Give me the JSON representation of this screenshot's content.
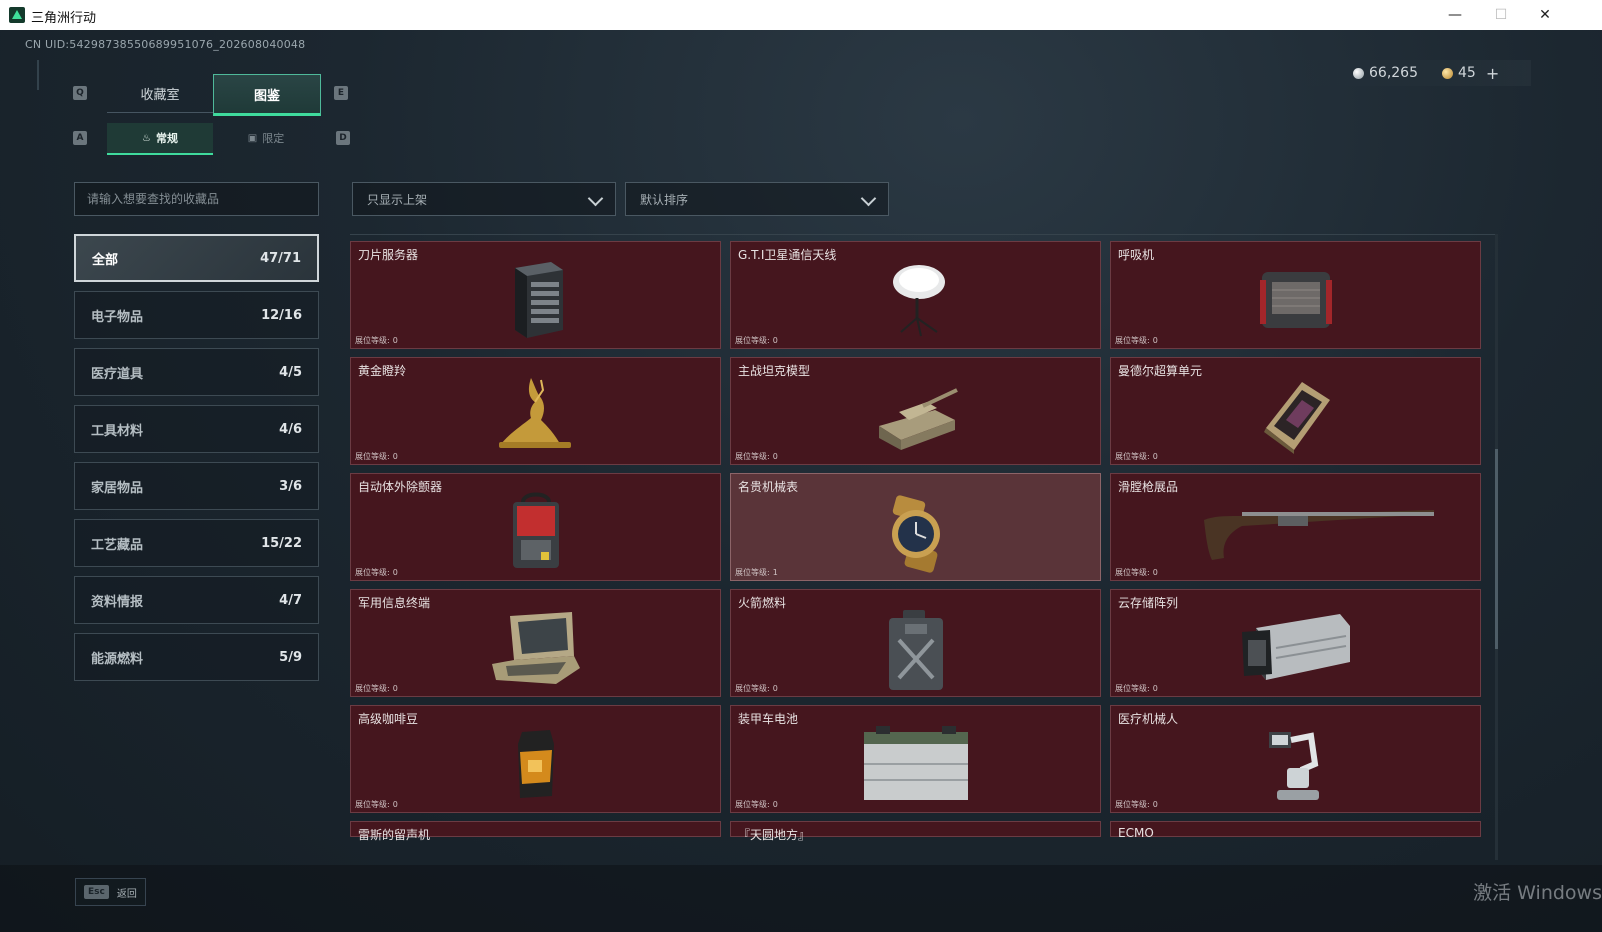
{
  "window": {
    "title": "三角洲行动",
    "minimize": "—",
    "maximize": "☐",
    "close": "✕"
  },
  "uid": "CN UID:5429873855068995107​6_202608040048",
  "currency": {
    "silver": "66,265",
    "gold": "45",
    "add": "+"
  },
  "keyhints": {
    "prev_tab": "Q",
    "next_tab": "E",
    "prev_sub": "A",
    "next_sub": "D"
  },
  "main_tabs": [
    "收藏室",
    "图鉴"
  ],
  "sub_tabs": [
    "常规",
    "限定"
  ],
  "search": {
    "placeholder": "请输入想要查找的收藏品"
  },
  "filters": {
    "shelf": "只显示上架",
    "sort": "默认排序"
  },
  "categories": [
    {
      "label": "全部",
      "count": "47/71"
    },
    {
      "label": "电子物品",
      "count": "12/16"
    },
    {
      "label": "医疗道具",
      "count": "4/5"
    },
    {
      "label": "工具材料",
      "count": "4/6"
    },
    {
      "label": "家居物品",
      "count": "3/6"
    },
    {
      "label": "工艺藏品",
      "count": "15/22"
    },
    {
      "label": "资料情报",
      "count": "4/7"
    },
    {
      "label": "能源燃料",
      "count": "5/9"
    }
  ],
  "level_label": "展位等级:",
  "items": [
    {
      "name": "刀片服务器",
      "level": "0",
      "icon": "server-icon"
    },
    {
      "name": "G.T.I卫星通信天线",
      "level": "0",
      "icon": "satellite-dish-icon"
    },
    {
      "name": "呼吸机",
      "level": "0",
      "icon": "ventilator-icon"
    },
    {
      "name": "黄金瞪羚",
      "level": "0",
      "icon": "gold-gazelle-icon"
    },
    {
      "name": "主战坦克模型",
      "level": "0",
      "icon": "tank-model-icon"
    },
    {
      "name": "曼德尔超算单元",
      "level": "0",
      "icon": "cpu-unit-icon"
    },
    {
      "name": "自动体外除颤器",
      "level": "0",
      "icon": "defibrillator-icon"
    },
    {
      "name": "名贵机械表",
      "level": "1",
      "icon": "watch-icon"
    },
    {
      "name": "滑膛枪展品",
      "level": "0",
      "icon": "musket-icon"
    },
    {
      "name": "军用信息终端",
      "level": "0",
      "icon": "terminal-case-icon"
    },
    {
      "name": "火箭燃料",
      "level": "0",
      "icon": "fuel-can-icon"
    },
    {
      "name": "云存储阵列",
      "level": "0",
      "icon": "storage-array-icon"
    },
    {
      "name": "高级咖啡豆",
      "level": "0",
      "icon": "coffee-bag-icon"
    },
    {
      "name": "装甲车电池",
      "level": "0",
      "icon": "battery-icon"
    },
    {
      "name": "医疗机械人",
      "level": "0",
      "icon": "medical-robot-icon"
    }
  ],
  "partial_items": [
    "雷斯的留声机",
    "『天圆地方』",
    "ECMO"
  ],
  "footer": {
    "esc_key": "Esc",
    "esc_label": "返回"
  },
  "watermark": "激活 Windows"
}
